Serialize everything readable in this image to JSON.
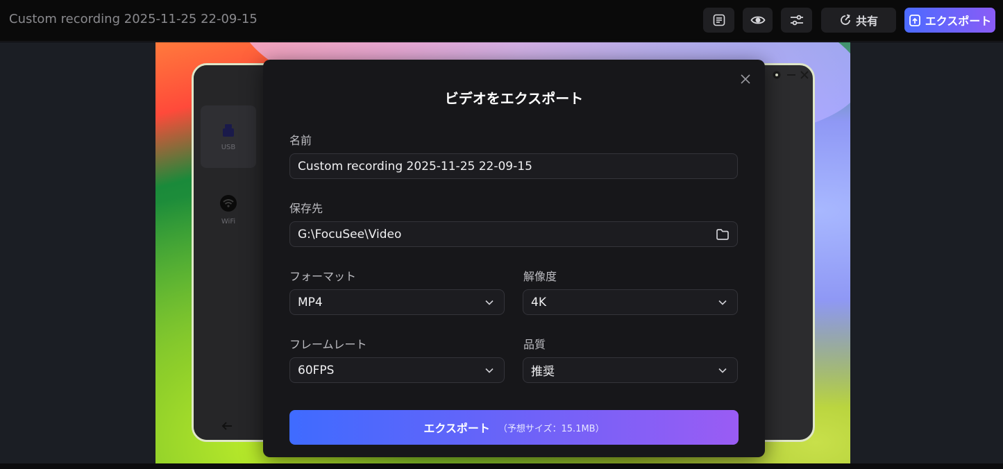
{
  "window": {
    "title": "Custom recording 2025-11-25 22-09-15"
  },
  "toolbar": {
    "list_icon": "list-icon",
    "preview_icon": "eye-icon",
    "adjust_icon": "sliders-icon",
    "share_label": "共有",
    "export_label": "エクスポート"
  },
  "device": {
    "usb_label": "USB",
    "wifi_label": "WiFi"
  },
  "dialog": {
    "title": "ビデオをエクスポート",
    "name_label": "名前",
    "name_value": "Custom recording 2025-11-25 22-09-15",
    "save_label": "保存先",
    "save_value": "G:\\FocuSee\\Video",
    "format_label": "フォーマット",
    "format_value": "MP4",
    "resolution_label": "解像度",
    "resolution_value": "4K",
    "framerate_label": "フレームレート",
    "framerate_value": "60FPS",
    "quality_label": "品質",
    "quality_value": "推奨",
    "export_button": "エクスポート",
    "estimated_size": "（予想サイズ：15.1MB）"
  },
  "colors": {
    "accent_start": "#3f6bff",
    "accent_end": "#9a5cf4",
    "modal_bg": "#17171a"
  }
}
